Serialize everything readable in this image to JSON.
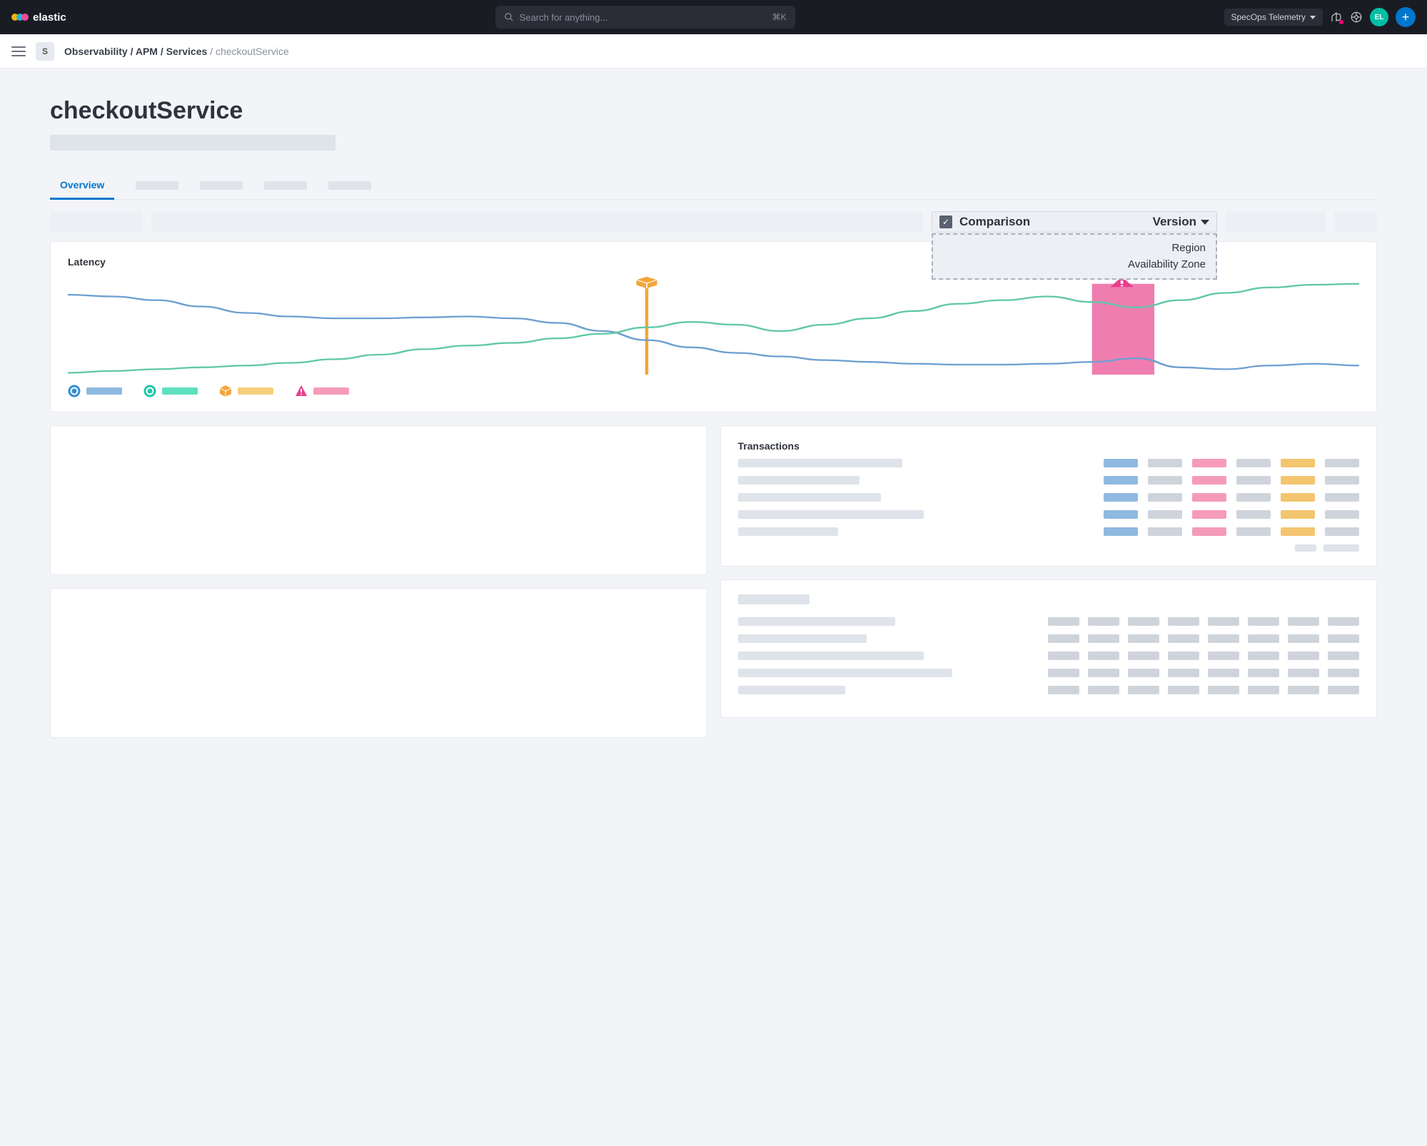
{
  "nav": {
    "brand": "elastic",
    "search_placeholder": "Search for anything...",
    "search_shortcut": "⌘K",
    "space_name": "SpecOps Telemetry",
    "avatar_initials": "EL"
  },
  "breadcrumb": {
    "space_initial": "S",
    "parts": [
      "Observability",
      "APM",
      "Services"
    ],
    "current": "checkoutService"
  },
  "page": {
    "title": "checkoutService"
  },
  "tabs": {
    "active": "Overview"
  },
  "comparison": {
    "label": "Comparison",
    "value": "Version",
    "options": [
      "Region",
      "Availability Zone"
    ]
  },
  "latency_card": {
    "title": "Latency"
  },
  "chart_data": {
    "type": "line",
    "title": "Latency",
    "xlabel": "",
    "ylabel": "",
    "series": [
      {
        "name": "series-blue",
        "color": "#6d9fd1",
        "values": [
          88,
          86,
          82,
          75,
          68,
          64,
          62,
          62,
          63,
          64,
          62,
          57,
          48,
          38,
          30,
          24,
          20,
          16,
          14,
          12,
          11,
          11,
          12,
          14,
          18,
          8,
          6,
          10,
          12,
          10
        ]
      },
      {
        "name": "series-green",
        "color": "#5fc8a6",
        "values": [
          2,
          4,
          6,
          8,
          10,
          13,
          17,
          22,
          28,
          32,
          35,
          40,
          45,
          52,
          58,
          55,
          48,
          55,
          62,
          70,
          78,
          82,
          86,
          80,
          74,
          82,
          90,
          96,
          99,
          100
        ]
      }
    ],
    "markers": [
      {
        "type": "deployment",
        "icon": "box",
        "color": "#f3a63a",
        "x_index": 13
      },
      {
        "type": "alert",
        "icon": "alert",
        "color": "#e83e8c",
        "x_index": 23,
        "span": 1.4
      }
    ],
    "legend": [
      {
        "icon": "circle",
        "color": "#2f8fd6",
        "bar_color": "#8fb9e0"
      },
      {
        "icon": "circle",
        "color": "#1ec8a5",
        "bar_color": "#5fe0bf"
      },
      {
        "icon": "box",
        "color": "#f3a63a",
        "bar_color": "#f6cf7a"
      },
      {
        "icon": "alert",
        "color": "#e83e8c",
        "bar_color": "#f59bb9"
      }
    ],
    "ylim": [
      0,
      100
    ]
  },
  "transactions": {
    "title": "Transactions",
    "rows": [
      {
        "name_w": 230,
        "cols": [
          "blue",
          "grey",
          "pink",
          "grey",
          "yellow",
          "grey"
        ]
      },
      {
        "name_w": 170,
        "cols": [
          "blue",
          "grey",
          "pink",
          "grey",
          "yellow",
          "grey"
        ]
      },
      {
        "name_w": 200,
        "cols": [
          "blue",
          "grey",
          "pink",
          "grey",
          "yellow",
          "grey"
        ]
      },
      {
        "name_w": 260,
        "cols": [
          "blue",
          "grey",
          "pink",
          "grey",
          "yellow",
          "grey"
        ]
      },
      {
        "name_w": 140,
        "cols": [
          "blue",
          "grey",
          "pink",
          "grey",
          "yellow",
          "grey"
        ]
      }
    ]
  },
  "bottom_card": {
    "rows": [
      {
        "name_w": 220,
        "cells": 8
      },
      {
        "name_w": 180,
        "cells": 8
      },
      {
        "name_w": 260,
        "cells": 8
      },
      {
        "name_w": 300,
        "cells": 8
      },
      {
        "name_w": 150,
        "cells": 8
      }
    ]
  }
}
